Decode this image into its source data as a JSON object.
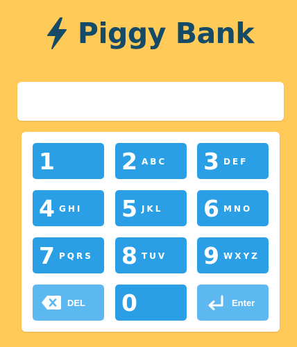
{
  "app": {
    "title": "Piggy Bank",
    "icon": "lightning-bolt-icon"
  },
  "display": {
    "value": ""
  },
  "keypad": {
    "keys": [
      {
        "digit": "1",
        "letters": ""
      },
      {
        "digit": "2",
        "letters": "ABC"
      },
      {
        "digit": "3",
        "letters": "DEF"
      },
      {
        "digit": "4",
        "letters": "GHI"
      },
      {
        "digit": "5",
        "letters": "JKL"
      },
      {
        "digit": "6",
        "letters": "MNO"
      },
      {
        "digit": "7",
        "letters": "PQRS"
      },
      {
        "digit": "8",
        "letters": "TUV"
      },
      {
        "digit": "9",
        "letters": "WXYZ"
      }
    ],
    "delete": {
      "label": "DEL",
      "icon": "backspace-icon"
    },
    "zero": {
      "digit": "0"
    },
    "enter": {
      "label": "Enter",
      "icon": "enter-return-icon"
    }
  },
  "colors": {
    "background": "#ffca57",
    "title": "#154b66",
    "key": "#2a9fe6",
    "key_secondary": "#5cb8ef"
  }
}
